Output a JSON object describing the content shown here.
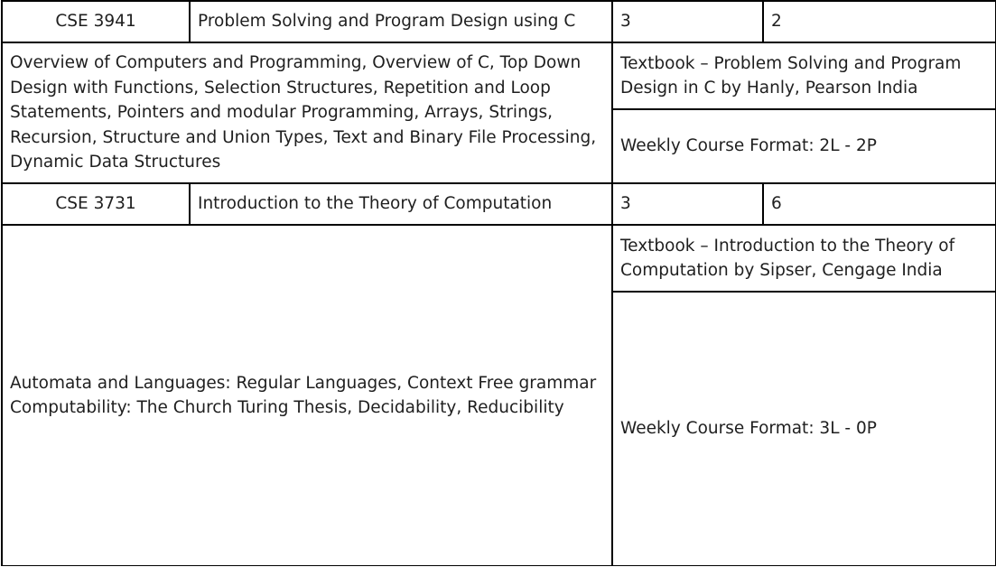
{
  "courses": [
    {
      "code": "CSE 3941",
      "title": "Problem Solving and Program Design using C",
      "col3": "3",
      "col4": "2",
      "description": "Overview of Computers and Programming, Overview of C, Top Down Design with Functions, Selection Structures, Repetition and Loop Statements, Pointers and modular Programming, Arrays, Strings, Recursion, Structure and Union Types, Text and Binary File Processing, Dynamic Data Structures",
      "textbook": "Textbook – Problem Solving and Program Design in C by Hanly, Pearson India",
      "format": "Weekly Course Format: 2L - 2P"
    },
    {
      "code": "CSE 3731",
      "title": "Introduction to the Theory of Computation",
      "col3": "3",
      "col4": "6",
      "description_line1": "Automata and Languages: Regular Languages, Context Free grammar",
      "description_line2": "Computability: The Church Turing Thesis, Decidability, Reducibility",
      "textbook": "Textbook – Introduction to the Theory of Computation by Sipser, Cengage India",
      "format": "Weekly Course Format: 3L - 0P"
    }
  ]
}
